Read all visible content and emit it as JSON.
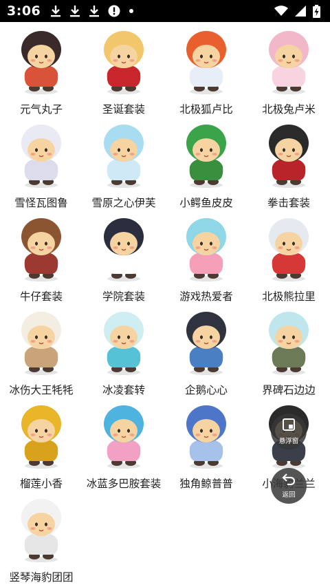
{
  "status_bar": {
    "time": "3:06",
    "left_icons": [
      "download-icon",
      "download-icon",
      "download-icon",
      "alert-circle-icon",
      "dot-icon"
    ],
    "right_icons": [
      "wifi-icon",
      "signal-icon",
      "battery-charging-icon"
    ]
  },
  "items": [
    {
      "label": "元气丸子",
      "icon": "character-avatar-icon",
      "hat": "#3a2a2a",
      "body": "#d9533b"
    },
    {
      "label": "圣诞套装",
      "icon": "character-avatar-icon",
      "hat": "#f2c66a",
      "body": "#c8262c"
    },
    {
      "label": "北极狐卢比",
      "icon": "character-avatar-icon",
      "hat": "#e9602f",
      "body": "#e8eef7"
    },
    {
      "label": "北极兔卢米",
      "icon": "character-avatar-icon",
      "hat": "#f2b7c8",
      "body": "#f7d4df"
    },
    {
      "label": "雪怪瓦图鲁",
      "icon": "character-avatar-icon",
      "hat": "#eaeaf4",
      "body": "#dcdcec"
    },
    {
      "label": "雪原之心伊芙",
      "icon": "character-avatar-icon",
      "hat": "#a8dcf0",
      "body": "#cfeaf6"
    },
    {
      "label": "小鳄鱼皮皮",
      "icon": "character-avatar-icon",
      "hat": "#3ba34a",
      "body": "#3a8f3e"
    },
    {
      "label": "拳击套装",
      "icon": "character-avatar-icon",
      "hat": "#2a2a2a",
      "body": "#b8242a"
    },
    {
      "label": "牛仔套装",
      "icon": "character-avatar-icon",
      "hat": "#8a5530",
      "body": "#9c3a32"
    },
    {
      "label": "学院套装",
      "icon": "character-avatar-icon",
      "hat": "#2a2e3e",
      "body": "#ffffff"
    },
    {
      "label": "游戏热爱者",
      "icon": "character-avatar-icon",
      "hat": "#8fd6e6",
      "body": "#f5a0b8"
    },
    {
      "label": "北极熊拉里",
      "icon": "character-avatar-icon",
      "hat": "#e6eaf0",
      "body": "#d63838"
    },
    {
      "label": "冰伤大王牦牦",
      "icon": "character-avatar-icon",
      "hat": "#f4ede2",
      "body": "#c9a47a"
    },
    {
      "label": "冰凌套转",
      "icon": "character-avatar-icon",
      "hat": "#cfeef2",
      "body": "#55c2d6"
    },
    {
      "label": "企鹅心心",
      "icon": "character-avatar-icon",
      "hat": "#2f3340",
      "body": "#4a7fc4"
    },
    {
      "label": "界碑石边边",
      "icon": "character-avatar-icon",
      "hat": "#bfe6ec",
      "body": "#6d7a58"
    },
    {
      "label": "榴莲小香",
      "icon": "character-avatar-icon",
      "hat": "#e8b628",
      "body": "#d9a21c"
    },
    {
      "label": "冰蓝多巴胺套装",
      "icon": "character-avatar-icon",
      "hat": "#4fb3e0",
      "body": "#f2a0c4"
    },
    {
      "label": "独角鲸普普",
      "icon": "character-avatar-icon",
      "hat": "#4e76c8",
      "body": "#a7c2ea"
    },
    {
      "label": "小海豹兰兰",
      "icon": "character-avatar-icon",
      "hat": "#2a2a2a",
      "body": "#3b3f4a"
    },
    {
      "label": "竖琴海豹团团",
      "icon": "character-avatar-icon",
      "hat": "#f2f2f2",
      "body": "#e6e6e6"
    }
  ],
  "float_buttons": {
    "floating_window": {
      "label": "悬浮窗",
      "icon": "floating-window-icon"
    },
    "back": {
      "label": "返回",
      "icon": "back-arrow-icon"
    }
  },
  "colors": {
    "status_bar_bg": "#000000",
    "page_bg": "#ffffff",
    "label_text": "#222222",
    "float_btn_bg": "#373737"
  }
}
